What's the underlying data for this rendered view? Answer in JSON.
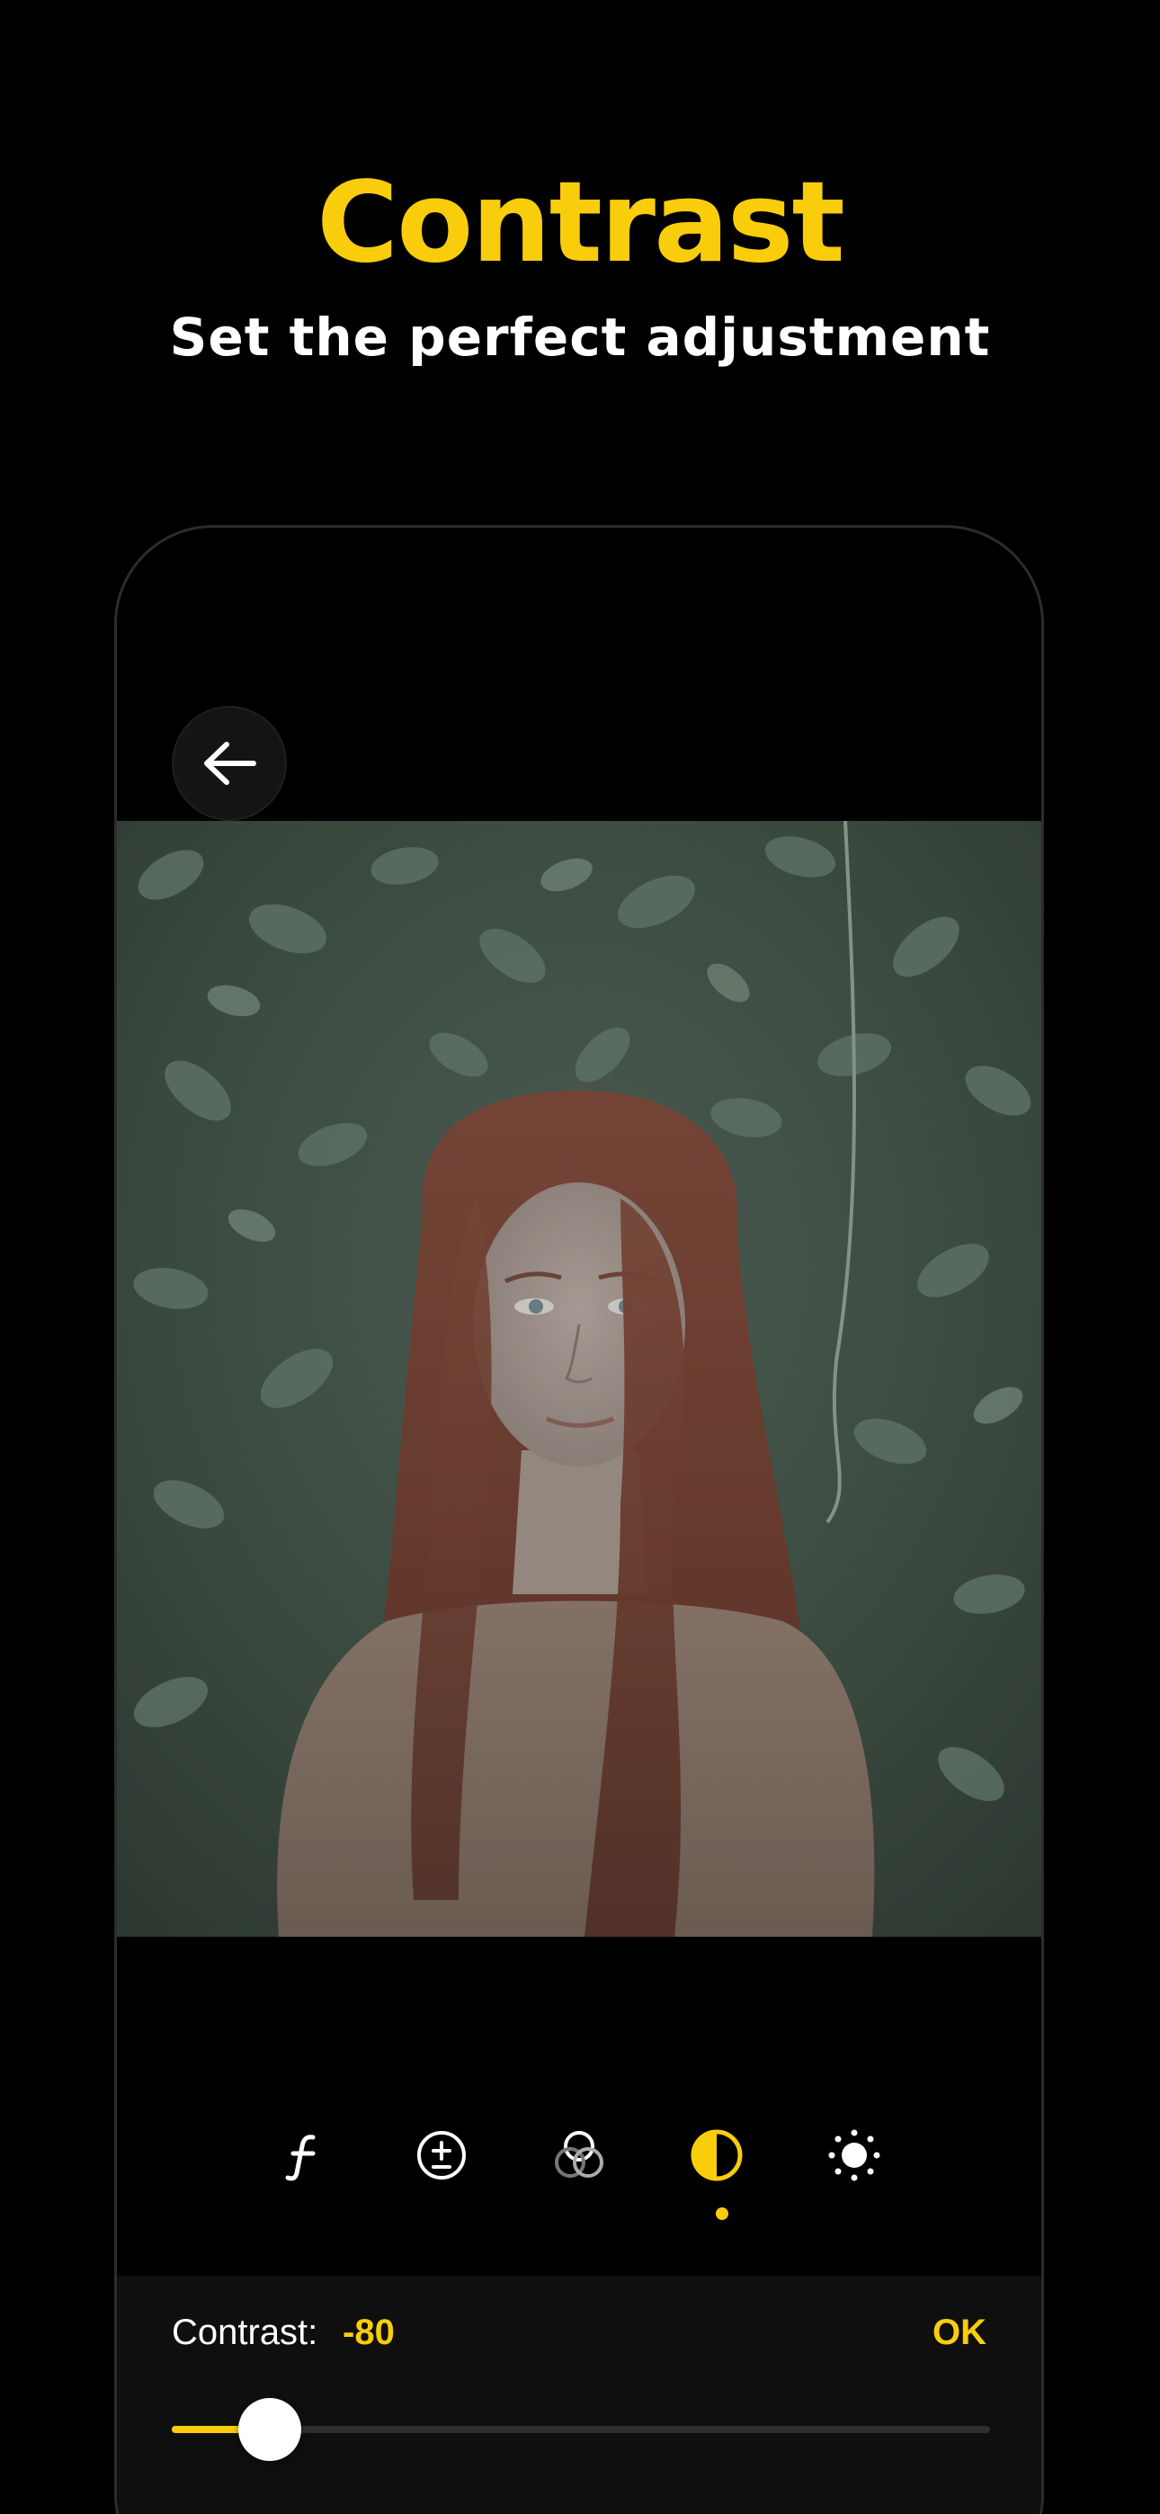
{
  "header": {
    "title": "Contrast",
    "subtitle": "Set the perfect adjustment"
  },
  "colors": {
    "accent": "#F9CD0C",
    "background": "#000000",
    "panel": "#0f0f0f"
  },
  "editor": {
    "back_icon": "arrow-left-icon",
    "photo_description_icon": "portrait-photo",
    "tools": [
      {
        "icon": "function-f-icon",
        "active": false
      },
      {
        "icon": "exposure-plus-minus-icon",
        "active": false
      },
      {
        "icon": "color-circles-icon",
        "active": false
      },
      {
        "icon": "contrast-half-circle-icon",
        "active": true
      },
      {
        "icon": "brightness-sun-icon",
        "active": false
      }
    ],
    "adjustment": {
      "label": "Contrast:",
      "value": "-80",
      "ok_label": "OK",
      "slider_fraction": 0.12
    }
  }
}
